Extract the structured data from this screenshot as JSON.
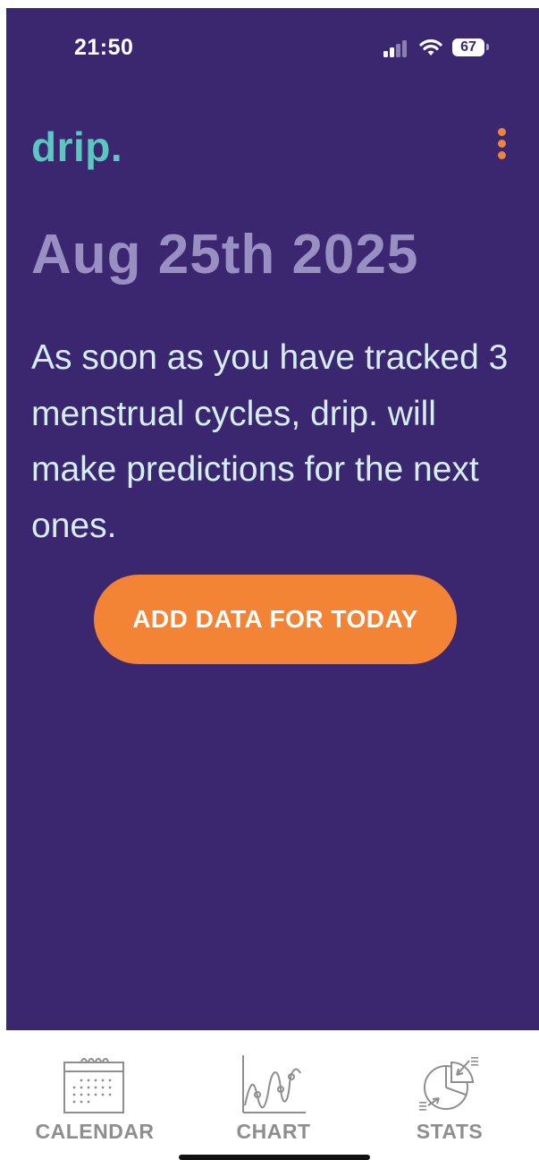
{
  "status_bar": {
    "time": "21:50",
    "battery_level": "67",
    "signal_bars_active": 2,
    "signal_bars_total": 4,
    "wifi": "wifi-icon"
  },
  "header": {
    "logo": "drip.",
    "menu_icon": "more-vertical-icon"
  },
  "main": {
    "date_title": "Aug 25th 2025",
    "prediction_text": "As soon as you have tracked 3 menstrual cycles, drip. will make predictions for the next ones.",
    "add_data_button": "ADD DATA FOR TODAY"
  },
  "tabbar": {
    "items": [
      {
        "label": "CALENDAR",
        "icon": "calendar-icon"
      },
      {
        "label": "CHART",
        "icon": "chart-icon"
      },
      {
        "label": "STATS",
        "icon": "stats-pie-icon"
      }
    ]
  },
  "colors": {
    "background": "#3b2770",
    "logo": "#5ac8c0",
    "accent": "#f38335",
    "date_title": "#9a8fc2",
    "body_text": "#d6eef2",
    "tab_inactive": "#8e8e8e"
  }
}
